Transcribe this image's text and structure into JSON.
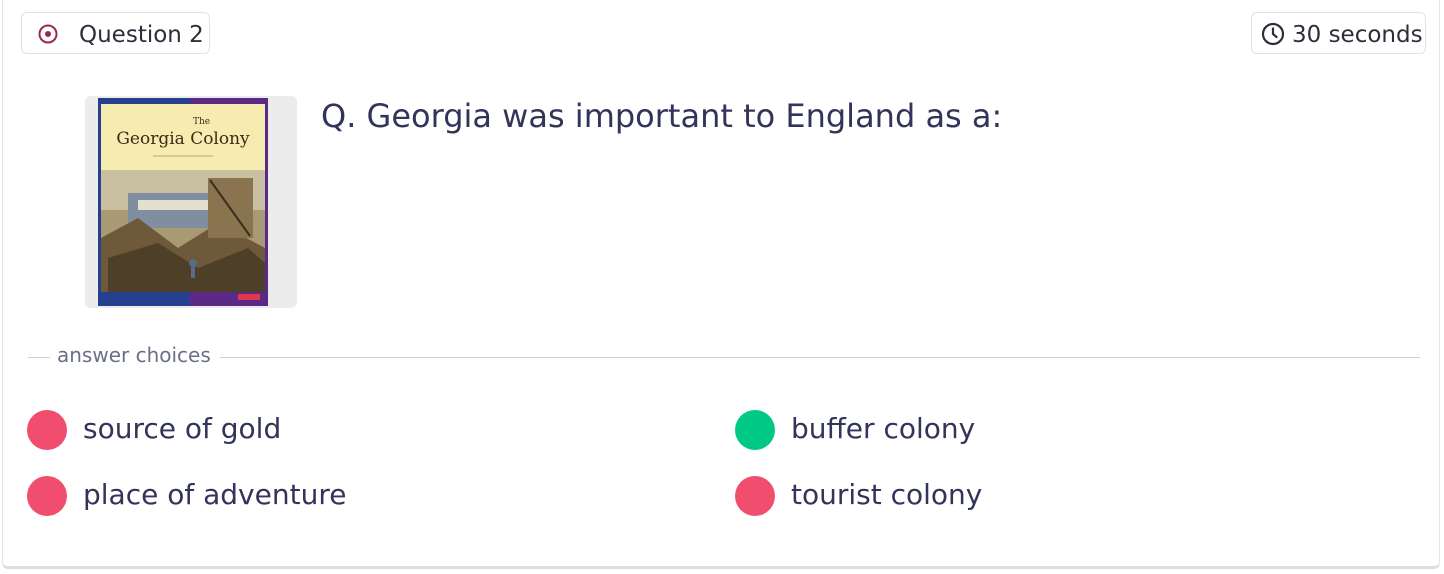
{
  "question": {
    "number_label": "Question 2",
    "timer_label": "30 seconds",
    "text": "Q. Georgia was important to England as a:",
    "image": {
      "title_small": "The",
      "title": "Georgia Colony",
      "description": "Book cover illustration"
    }
  },
  "answers": {
    "section_label": "answer choices",
    "choices": [
      {
        "label": "source of gold",
        "status": "incorrect",
        "color": "#f14d6e"
      },
      {
        "label": "buffer colony",
        "status": "correct",
        "color": "#00c985"
      },
      {
        "label": "place of adventure",
        "status": "incorrect",
        "color": "#f14d6e"
      },
      {
        "label": "tourist colony",
        "status": "incorrect",
        "color": "#f14d6e"
      }
    ]
  },
  "colors": {
    "accent": "#9b2a4a",
    "text": "#33345a",
    "correct": "#00c985",
    "incorrect": "#f14d6e"
  }
}
